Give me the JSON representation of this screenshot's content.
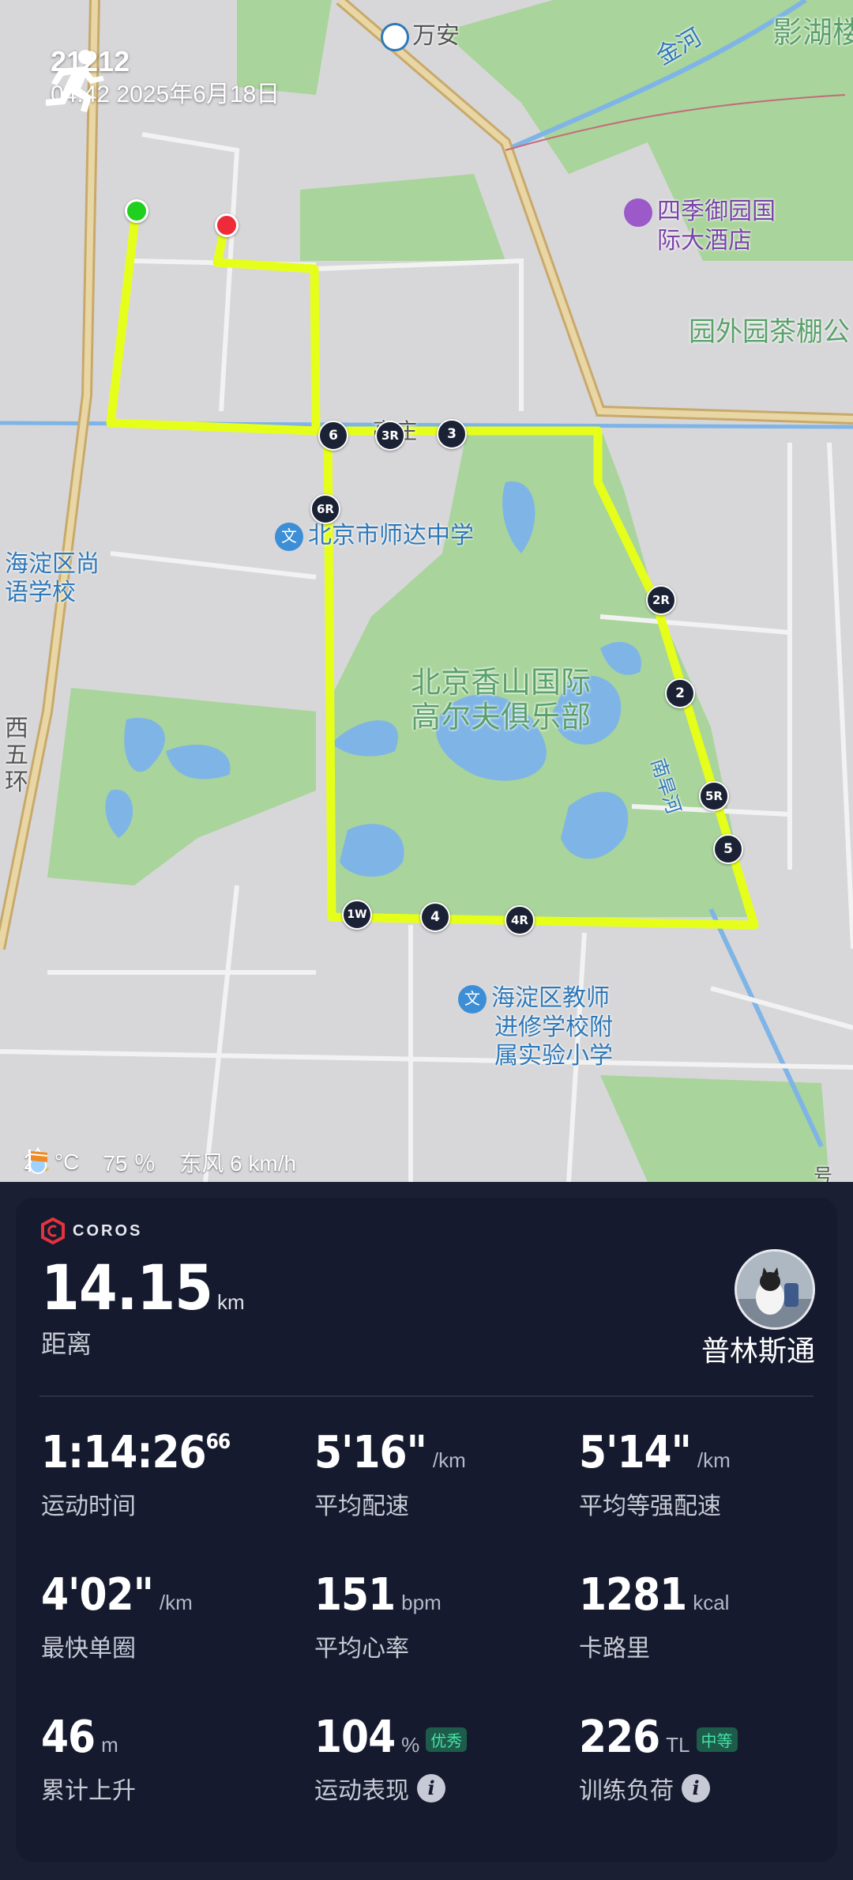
{
  "header": {
    "name": "21212",
    "datetime": "04:42 2025年6月18日"
  },
  "map": {
    "labels": {
      "wanan": "万安",
      "yinghu": "影湖楼",
      "jinhe": "金河",
      "hotel_line1": "四季御园国",
      "hotel_line2": "际大酒店",
      "yuanwai": "园外园茶棚公",
      "street": "亭庄",
      "school1": "北京市师达中学",
      "school2_line1": "海淀区尚",
      "school2_line2": "语学校",
      "golf_line1": "北京香山国际",
      "golf_line2": "高尔夫俱乐部",
      "ring_line1": "西",
      "ring_line2": "五",
      "ring_line3": "环",
      "road_right": "南旱河",
      "school3_line1": "海淀区教师",
      "school3_line2": "进修学校附",
      "school3_line3": "属实验小学",
      "corner": "号"
    },
    "lap_markers": [
      "6",
      "3R",
      "3",
      "6R",
      "2R",
      "2",
      "5R",
      "5",
      "1W",
      "4",
      "4R"
    ],
    "colors": {
      "route": "#e6ff1a",
      "start": "#1fd01f",
      "end": "#ef2b3a",
      "park": "#a9d49b",
      "water": "#7fb5e6"
    }
  },
  "weather": {
    "temperature": "21 °C",
    "humidity": "75 ％",
    "wind": "东风 6 km/h"
  },
  "card": {
    "brand": "COROS",
    "distance_value": "14.15",
    "distance_unit": "km",
    "distance_label": "距离",
    "username": "普林斯通",
    "stats": {
      "time": {
        "value": "1:14:26",
        "sup": "66",
        "label": "运动时间"
      },
      "avg_pace": {
        "value": "5'16\"",
        "unit": "/km",
        "label": "平均配速"
      },
      "grade_pace": {
        "value": "5'14\"",
        "unit": "/km",
        "label": "平均等强配速"
      },
      "fastest_lap": {
        "value": "4'02\"",
        "unit": "/km",
        "label": "最快单圈"
      },
      "heart_rate": {
        "value": "151",
        "unit": "bpm",
        "label": "平均心率"
      },
      "calories": {
        "value": "1281",
        "unit": "kcal",
        "label": "卡路里"
      },
      "ascent": {
        "value": "46",
        "unit": "m",
        "label": "累计上升"
      },
      "performance": {
        "value": "104",
        "unit": "%",
        "badge": "优秀",
        "label": "运动表现"
      },
      "training_load": {
        "value": "226",
        "unit": "TL",
        "badge": "中等",
        "label": "训练负荷"
      }
    }
  }
}
